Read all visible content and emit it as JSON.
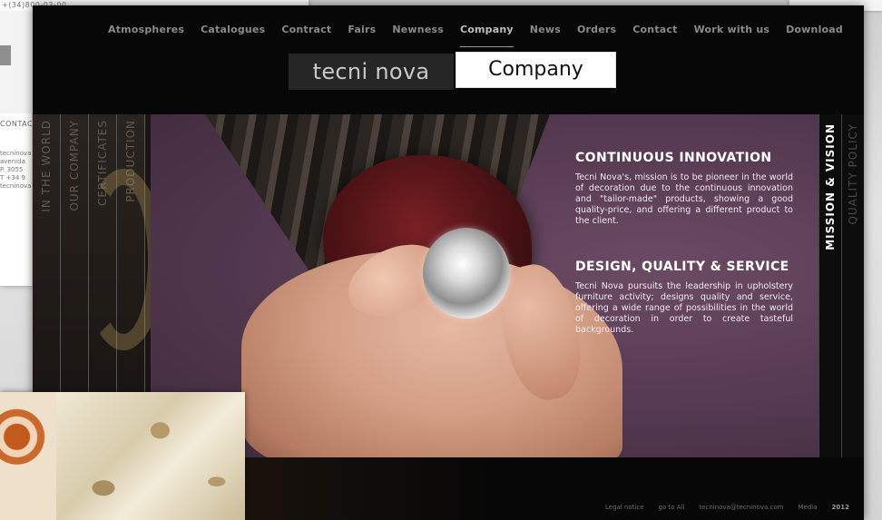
{
  "background_page": {
    "top_strip_text": "+(34)800-03-00",
    "contact_label": "CONTACT",
    "lines": [
      "tecninova",
      "avenida",
      "P. 3055",
      "T +34 9",
      "tecninova"
    ]
  },
  "nav": {
    "items": [
      "Atmospheres",
      "Catalogues",
      "Contract",
      "Fairs",
      "Newness",
      "Company",
      "News",
      "Orders",
      "Contact",
      "Work with us",
      "Download"
    ],
    "active": "Company"
  },
  "header": {
    "logo": "tecni nova",
    "page_title": "Company"
  },
  "left_tabs": [
    "IN THE WORLD",
    "OUR COMPANY",
    "CERTIFICATES",
    "PRODUCTION"
  ],
  "right_tabs": {
    "active": "MISSION & VISION",
    "inactive": "QUALITY POLICY"
  },
  "content": {
    "section1_title": "CONTINUOUS INNOVATION",
    "section1_text": "Tecni Nova's, mission is to be pioneer in the world of decoration due to the continuous innovation and \"tailor-made\" products, showing a good quality-price, and offering a different product to the client.",
    "section2_title": "DESIGN, QUALITY & SERVICE",
    "section2_text": "Tecni Nova pursuits the leadership in upholstery furniture activity; designs quality and service, offering a wide range of possibilities in the world of decoration in order to create tasteful backgrounds."
  },
  "footer": {
    "links": [
      "Legal notice",
      "go to All",
      "tecninova@tecninova.com",
      "Media",
      "2012"
    ]
  }
}
